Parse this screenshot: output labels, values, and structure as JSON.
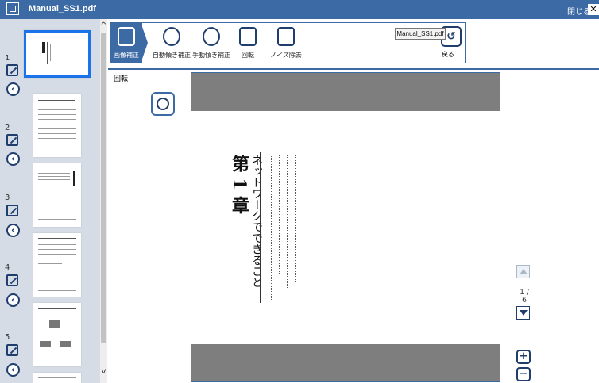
{
  "window": {
    "title": "Manual_SS1.pdf",
    "close_label": "閉じる",
    "close_glyph": "✕"
  },
  "sidebar": {
    "pages": [
      {
        "number": "1",
        "selected": true
      },
      {
        "number": "2"
      },
      {
        "number": "3"
      },
      {
        "number": "4"
      },
      {
        "number": "5"
      }
    ],
    "scroll_up": "^",
    "scroll_down": "v"
  },
  "toolbar": {
    "tools": [
      {
        "label": "画像補正",
        "icon": "image-correction-icon",
        "active": true
      },
      {
        "label": "自動傾き補正",
        "icon": "auto-skew-icon"
      },
      {
        "label": "手動傾き補正",
        "icon": "manual-skew-icon"
      },
      {
        "label": "回転",
        "icon": "rotate-icon"
      },
      {
        "label": "ノイズ除去",
        "icon": "noise-removal-icon"
      }
    ],
    "back_label": "戻る",
    "back_glyph": "↺",
    "tooltip": "Manual_SS1.pdf"
  },
  "main": {
    "section_label": "回転",
    "rotate_glyph": "↺",
    "document": {
      "chapter": "第 1 章",
      "chapter_title": "ネットワークでできること"
    },
    "page_indicator": "1 / 6",
    "zoom_in": "+",
    "zoom_out": "−"
  },
  "colors": {
    "accent": "#3c6aa5",
    "dark": "#1f3e6e",
    "sidebar_bg": "#d5dce6",
    "selected": "#1a73e8",
    "page_gray": "#7e7e7e"
  }
}
